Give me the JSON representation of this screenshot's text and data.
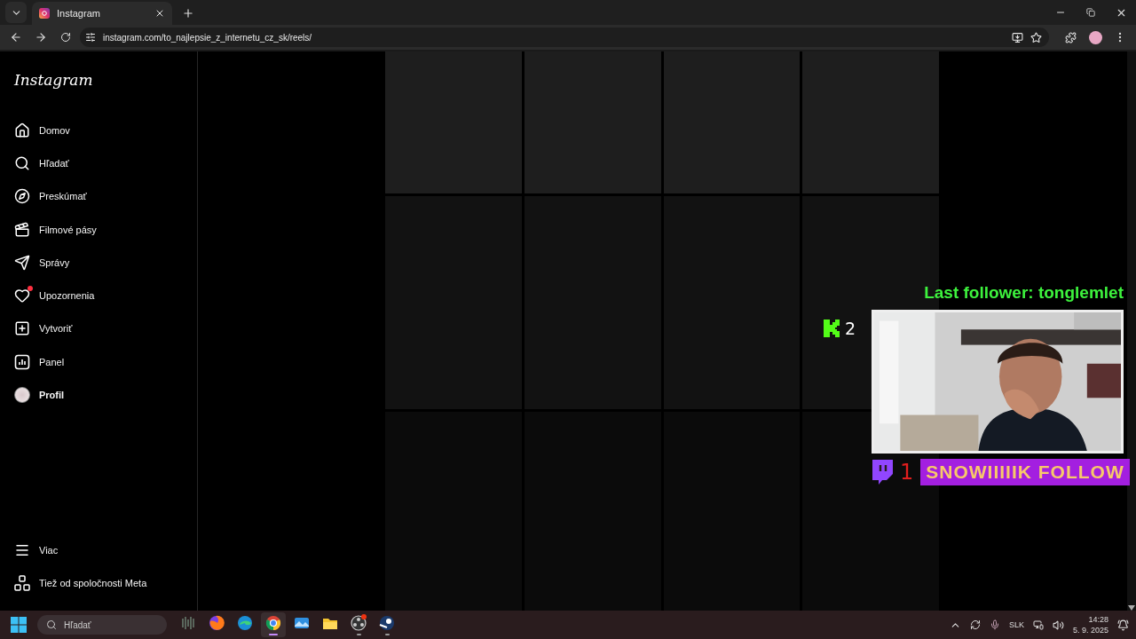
{
  "browser": {
    "tab_title": "Instagram",
    "url": "instagram.com/to_najlepsie_z_internetu_cz_sk/reels/"
  },
  "sidebar": {
    "logo": "Instagram",
    "items": [
      {
        "label": "Domov",
        "selected": false,
        "notification": false
      },
      {
        "label": "Hľadať",
        "selected": false,
        "notification": false
      },
      {
        "label": "Preskúmať",
        "selected": false,
        "notification": false
      },
      {
        "label": "Filmové pásy",
        "selected": false,
        "notification": false
      },
      {
        "label": "Správy",
        "selected": false,
        "notification": false
      },
      {
        "label": "Upozornenia",
        "selected": false,
        "notification": true
      },
      {
        "label": "Vytvoriť",
        "selected": false,
        "notification": false
      },
      {
        "label": "Panel",
        "selected": false,
        "notification": false
      },
      {
        "label": "Profil",
        "selected": true,
        "notification": false
      }
    ],
    "bottom_items": [
      {
        "label": "Viac"
      },
      {
        "label": "Tiež od spoločnosti Meta"
      }
    ]
  },
  "stream_overlay": {
    "last_follower": "Last follower: tonglemlet",
    "kick_count": "2",
    "twitch_count": "1",
    "banner": "SNOWIIIIIK FOLLOW"
  },
  "taskbar": {
    "search_placeholder": "Hľadať",
    "apps": [
      {
        "selected": false,
        "running": false
      },
      {
        "selected": false,
        "running": false
      },
      {
        "selected": false,
        "running": false
      },
      {
        "selected": true,
        "running": true
      },
      {
        "selected": false,
        "running": false
      },
      {
        "selected": false,
        "running": false
      },
      {
        "selected": false,
        "running": true
      },
      {
        "selected": false,
        "running": true
      }
    ],
    "language": "SLK",
    "time": "14:28",
    "date": "5. 9. 2025"
  }
}
